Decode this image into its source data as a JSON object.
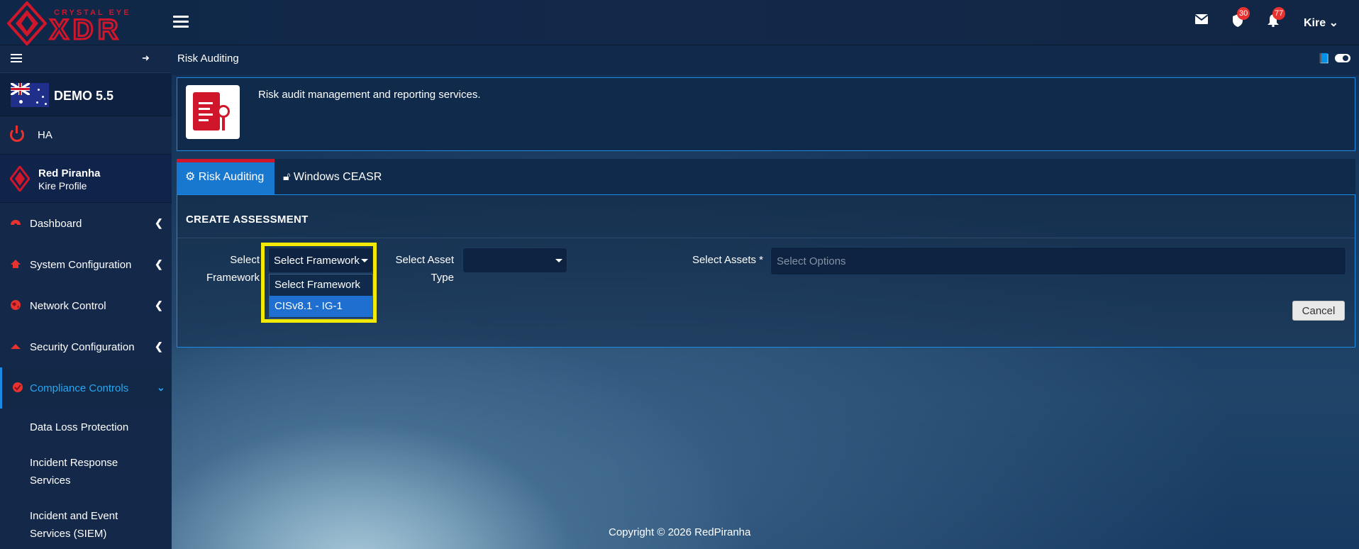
{
  "header": {
    "logo_tagline": "CRYSTAL EYE",
    "logo_word": "XDR",
    "shield_badge": "30",
    "bell_badge": "77",
    "user": "Kire"
  },
  "sidebar": {
    "device_name": "DEMO 5.5",
    "ha_label": "HA",
    "org_name": "Red Piranha",
    "profile_name": "Kire Profile",
    "items": [
      {
        "label": "Dashboard"
      },
      {
        "label": "System Configuration"
      },
      {
        "label": "Network Control"
      },
      {
        "label": "Security Configuration"
      },
      {
        "label": "Compliance Controls"
      }
    ],
    "sub_items": [
      {
        "label": "Data Loss Protection"
      },
      {
        "label": "Incident Response Services"
      },
      {
        "label": "Incident and Event Services (SIEM)"
      }
    ]
  },
  "page": {
    "title": "Risk Auditing",
    "description": "Risk audit management and reporting services.",
    "tabs": [
      {
        "label": "Risk Auditing"
      },
      {
        "label": "Windows CEASR"
      }
    ],
    "panel_heading": "CREATE ASSESSMENT",
    "fields": {
      "framework_label": "Select Framework",
      "framework_value": "Select Framework",
      "asset_type_label": "Select Asset Type",
      "asset_type_value": "",
      "assets_label": "Select Assets *",
      "assets_placeholder": "Select Options"
    },
    "framework_options": [
      {
        "label": "Select Framework"
      },
      {
        "label": "CISv8.1 - IG-1"
      }
    ],
    "cancel_label": "Cancel"
  },
  "footer": "Copyright © 2026 RedPiranha",
  "colors": {
    "brand_red": "#d0162b",
    "accent_blue": "#1c8be6",
    "highlight_yellow": "#f2ea06"
  }
}
